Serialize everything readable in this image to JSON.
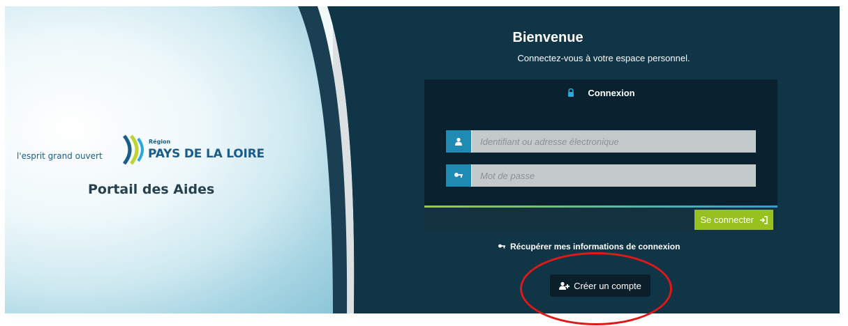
{
  "branding": {
    "tagline": "l'esprit grand ouvert",
    "region_label": "Région",
    "region_name": "PAYS DE LA LOIRE",
    "portal_title": "Portail des Aides"
  },
  "welcome": {
    "title": "Bienvenue",
    "subtitle": "Connectez-vous à votre espace personnel."
  },
  "login": {
    "header": "Connexion",
    "username_placeholder": "Identifiant ou adresse électronique",
    "password_placeholder": "Mot de passe",
    "submit_label": "Se connecter"
  },
  "links": {
    "recover_label": "Récupérer mes informations de connexion",
    "create_account_label": "Créer un compte"
  },
  "colors": {
    "background": "#0f3547",
    "accent_blue": "#1f8bb3",
    "accent_green": "#97c11e",
    "highlight_red": "#e01818"
  }
}
